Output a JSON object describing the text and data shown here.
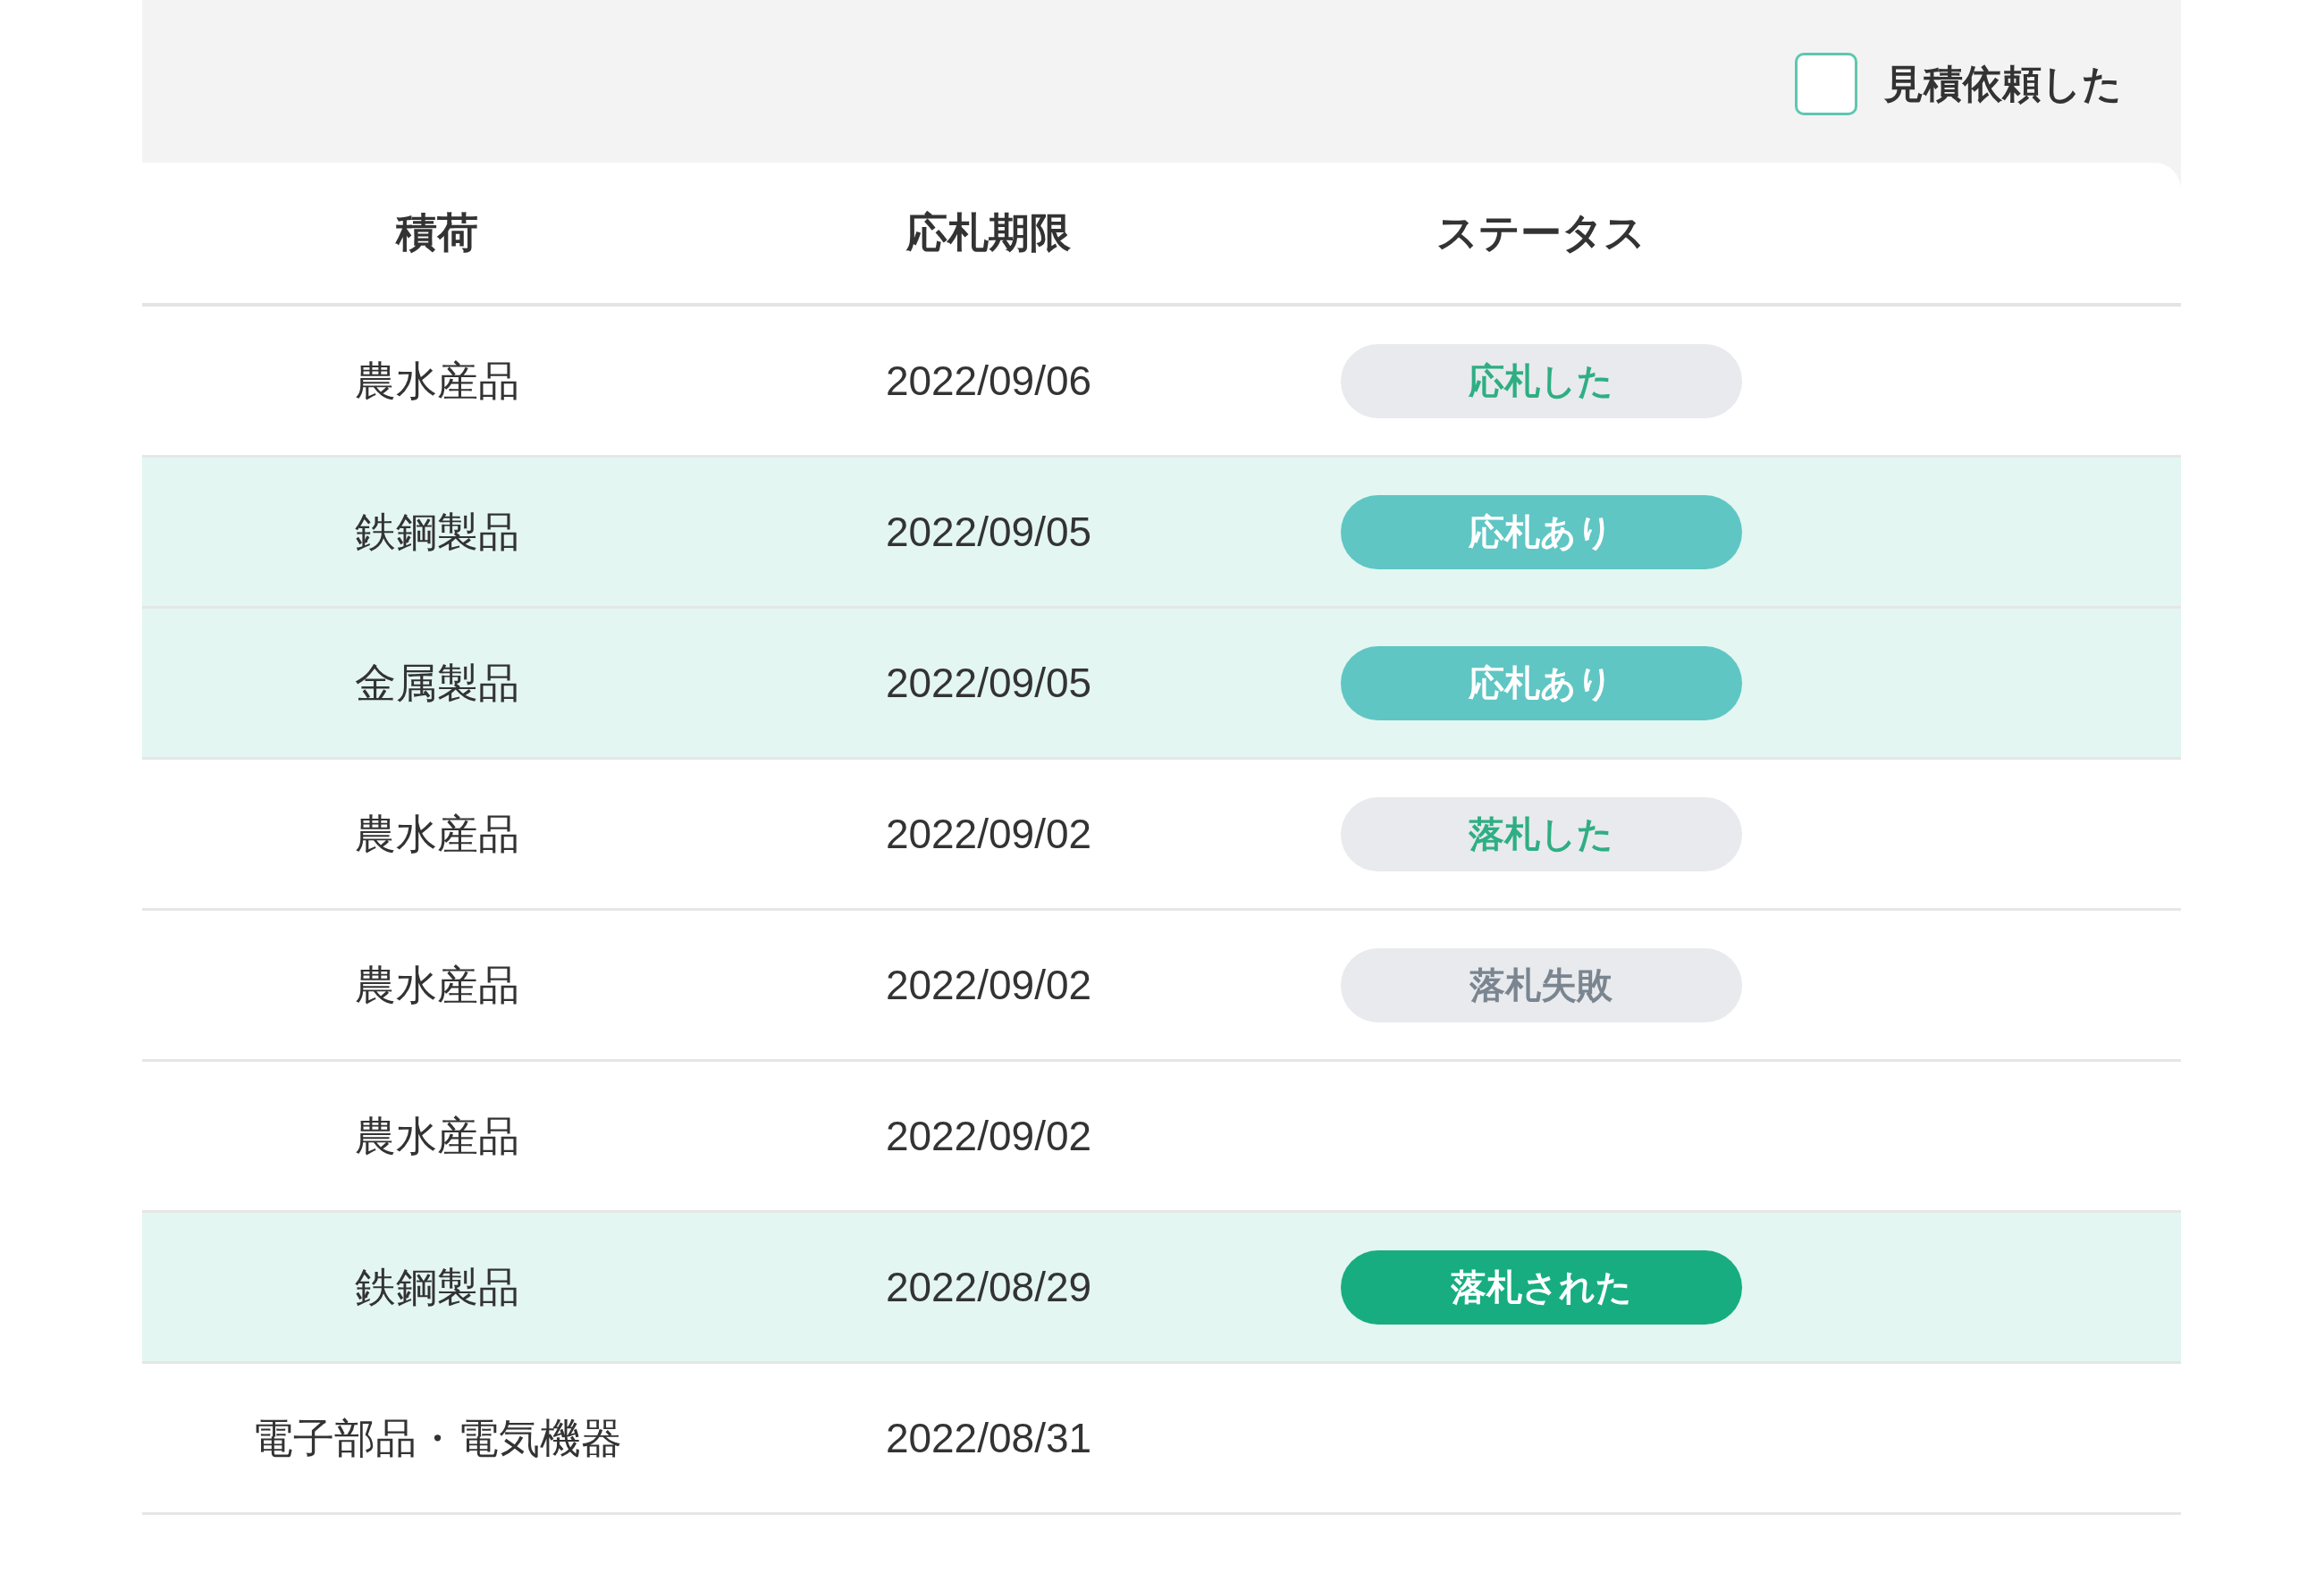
{
  "filter": {
    "label": "見積依頼した",
    "checked": false
  },
  "table": {
    "columns": [
      "積荷",
      "応札期限",
      "ステータス"
    ],
    "rows": [
      {
        "cargo": "農水産品",
        "deadline": "2022/09/06",
        "highlighted": false,
        "status": {
          "kind": "bid-placed",
          "label": "応札した"
        }
      },
      {
        "cargo": "鉄鋼製品",
        "deadline": "2022/09/05",
        "highlighted": true,
        "status": {
          "kind": "has-bids",
          "label": "応札あり"
        }
      },
      {
        "cargo": "金属製品",
        "deadline": "2022/09/05",
        "highlighted": true,
        "status": {
          "kind": "has-bids",
          "label": "応札あり"
        }
      },
      {
        "cargo": "農水産品",
        "deadline": "2022/09/02",
        "highlighted": false,
        "status": {
          "kind": "won",
          "label": "落札した"
        }
      },
      {
        "cargo": "農水産品",
        "deadline": "2022/09/02",
        "highlighted": false,
        "status": {
          "kind": "lost",
          "label": "落札失敗"
        }
      },
      {
        "cargo": "農水産品",
        "deadline": "2022/09/02",
        "highlighted": false
      },
      {
        "cargo": "鉄鋼製品",
        "deadline": "2022/08/29",
        "highlighted": true,
        "status": {
          "kind": "awarded",
          "label": "落札された"
        }
      },
      {
        "cargo": "電子部品・電気機器",
        "deadline": "2022/08/31",
        "highlighted": false
      }
    ]
  }
}
